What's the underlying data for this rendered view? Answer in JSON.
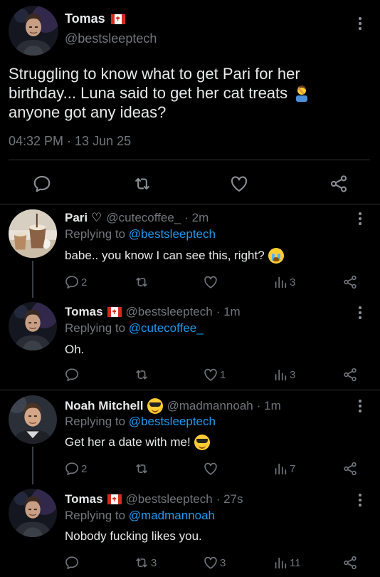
{
  "main_tweet": {
    "author_name": "Tomas",
    "author_handle": "@bestsleeptech",
    "text_line1": "Struggling to know what to get Pari for her",
    "text_line2": "birthday... Luna said to get her cat treats",
    "text_line3": "anyone got any ideas?",
    "timestamp": "04:32 PM · 13 Jun 25"
  },
  "replies": [
    {
      "author_name": "Pari",
      "author_badge": "♡",
      "author_handle": "@cutecoffee_",
      "age": "· 2m",
      "replying_prefix": "Replying to",
      "replying_to": "@bestsleeptech",
      "text": "babe.. you know I can see this, right?",
      "reply_count": "2",
      "retweet_count": "",
      "like_count": "",
      "view_count": "3"
    },
    {
      "author_name": "Tomas",
      "author_handle": "@bestsleeptech",
      "age": "· 1m",
      "replying_prefix": "Replying to",
      "replying_to": "@cutecoffee_",
      "text": "Oh.",
      "reply_count": "",
      "retweet_count": "",
      "like_count": "1",
      "view_count": "3"
    },
    {
      "author_name": "Noah Mitchell",
      "author_handle": "@madmannoah",
      "age": "· 1m",
      "replying_prefix": "Replying to",
      "replying_to": "@bestsleeptech",
      "text": "Get her a date with me!",
      "reply_count": "2",
      "retweet_count": "",
      "like_count": "",
      "view_count": "7"
    },
    {
      "author_name": "Tomas",
      "author_handle": "@bestsleeptech",
      "age": "· 27s",
      "replying_prefix": "Replying to",
      "replying_to": "@madmannoah",
      "text": "Nobody fucking likes you.",
      "reply_count": "",
      "retweet_count": "3",
      "like_count": "3",
      "view_count": "11"
    }
  ],
  "colors": {
    "background": "#000000",
    "text": "#e7e9ea",
    "muted": "#71767b",
    "link": "#1d9bf0",
    "divider": "#2f3336"
  },
  "icons": {
    "reply": "speech-bubble-icon",
    "retweet": "retweet-icon",
    "like": "heart-icon",
    "views": "bar-chart-icon",
    "share": "share-icon",
    "more": "kebab-icon"
  }
}
